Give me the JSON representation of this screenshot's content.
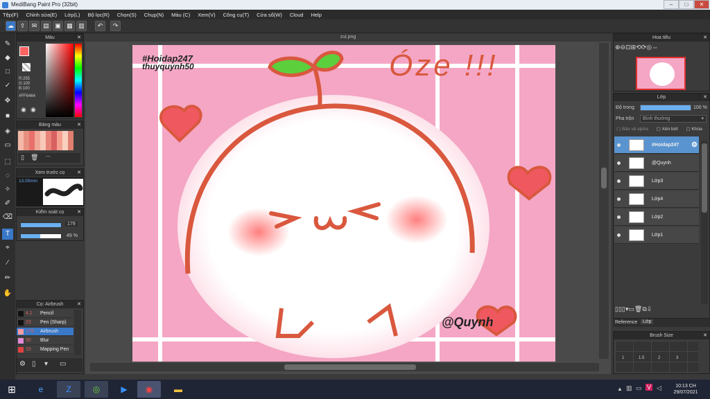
{
  "app": {
    "title": "MediBang Paint Pro (32bit)"
  },
  "menu": [
    "Tệp(F)",
    "Chỉnh sửa(E)",
    "Lớp(L)",
    "Bộ lọc(R)",
    "Chọn(S)",
    "Chụp(N)",
    "Màu (C)",
    "Xem(V)",
    "Công cụ(T)",
    "Cửa sổ(W)",
    "Cloud",
    "Help"
  ],
  "document": {
    "tab": "zui.png"
  },
  "panels": {
    "color": {
      "title": "Màu",
      "rgb_r": "R:255",
      "rgb_g": "G:100",
      "rgb_b": "B:100",
      "hex": "#FF6464"
    },
    "palette": {
      "title": "Bảng màu",
      "extra": "---"
    },
    "brush_preview": {
      "title": "Xem trước cọ",
      "size": "13.05mm"
    },
    "brush_control": {
      "title": "Kiểm soát cọ",
      "size": "179",
      "opacity": "49 %",
      "size_level": 0.85,
      "opacity_level": 0.49
    },
    "brushes": {
      "title": "Cọ: Airbrush",
      "items": [
        {
          "size": "4.1",
          "name": "Pencil",
          "color": "#111111"
        },
        {
          "size": "23",
          "name": "Pen (Sharp)",
          "color": "#111111"
        },
        {
          "size": "179",
          "name": "Airbrush",
          "color": "#ff9aa0",
          "selected": true
        },
        {
          "size": "50",
          "name": "Blur",
          "color": "#e28ad6"
        },
        {
          "size": "15",
          "name": "Mapping Pen",
          "color": "#e04040"
        }
      ]
    },
    "navigator": {
      "title": "Hoa tiêu"
    },
    "layers": {
      "title": "Lớp",
      "opacity_label": "Độ trong",
      "opacity_value": "100 %",
      "opacity_level": 1.0,
      "blend_label": "Pha trộn",
      "blend_value": "Bình thường",
      "protect_alpha": "Bảo vệ alpha",
      "clipping": "Xén bớt",
      "lock": "Khóa",
      "items": [
        {
          "name": "#Hoidap247",
          "selected": true
        },
        {
          "name": "@Quynh",
          "selected": false
        },
        {
          "name": "Lớp3",
          "selected": false
        },
        {
          "name": "Lớp4",
          "selected": false
        },
        {
          "name": "Lớp2",
          "selected": false
        },
        {
          "name": "Lớp1",
          "selected": false
        }
      ]
    },
    "bottom_tabs": {
      "reference": "Reference",
      "layer": "Lớp"
    },
    "brush_size": {
      "title": "Brush Size",
      "values": [
        "1",
        "1.5",
        "2",
        "3"
      ]
    }
  },
  "artwork": {
    "tag1": "#Hoidap247",
    "tag2": "thuyquynh50",
    "shout": "Óze !!!",
    "face": ">ω<",
    "signature": "@Quynh"
  },
  "taskbar": {
    "time": "10:13 CH",
    "date": "29/07/2021"
  }
}
